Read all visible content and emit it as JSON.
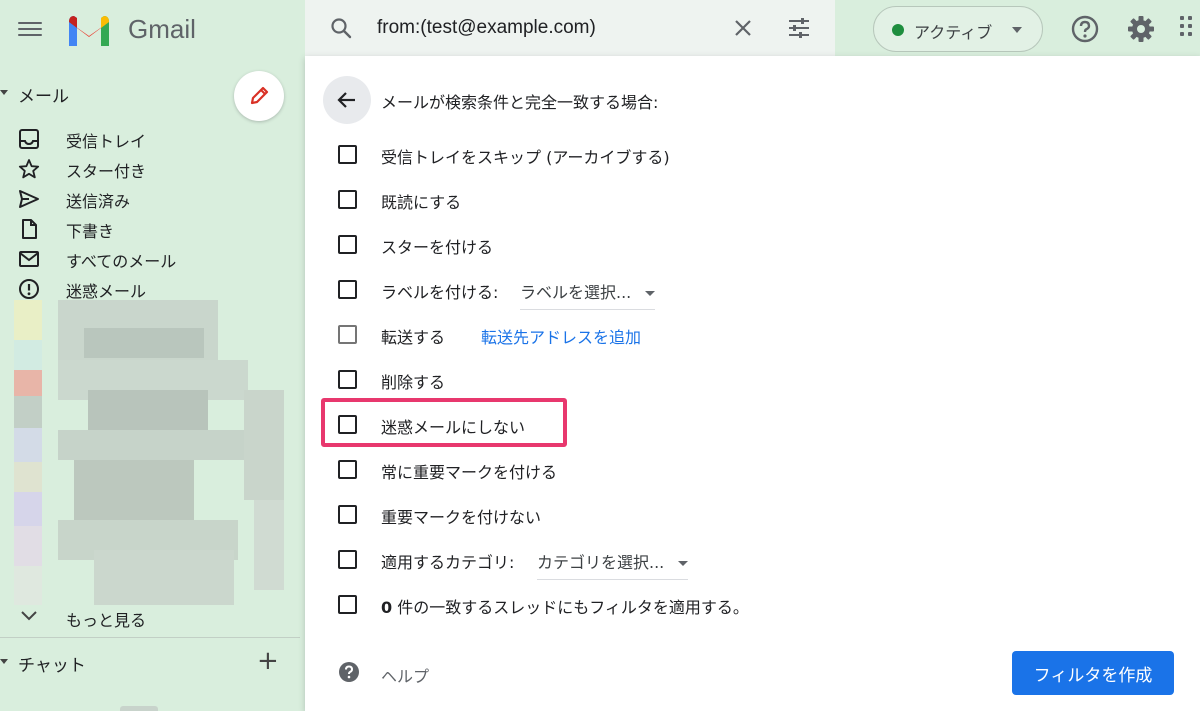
{
  "header": {
    "brand": "Gmail",
    "search_query": "from:(test@example.com)",
    "status_label": "アクティブ",
    "status_color": "#1e8e3e"
  },
  "sidebar": {
    "mail_section_title": "メール",
    "items": [
      {
        "label": "受信トレイ",
        "icon": "inbox-icon"
      },
      {
        "label": "スター付き",
        "icon": "star-icon"
      },
      {
        "label": "送信済み",
        "icon": "send-icon"
      },
      {
        "label": "下書き",
        "icon": "draft-icon"
      },
      {
        "label": "すべてのメール",
        "icon": "mail-icon"
      },
      {
        "label": "迷惑メール",
        "icon": "spam-icon"
      }
    ],
    "more_label": "もっと見る",
    "chat_label": "チャット"
  },
  "filter": {
    "title": "メールが検索条件と完全一致する場合:",
    "options": [
      {
        "label": "受信トレイをスキップ (アーカイブする)",
        "checked": false
      },
      {
        "label": "既読にする",
        "checked": false
      },
      {
        "label": "スターを付ける",
        "checked": false
      },
      {
        "label": "ラベルを付ける:",
        "checked": false,
        "select": "ラベルを選択..."
      },
      {
        "label": "転送する",
        "checked": false,
        "link": "転送先アドレスを追加"
      },
      {
        "label": "削除する",
        "checked": false
      },
      {
        "label": "迷惑メールにしない",
        "checked": false
      },
      {
        "label": "常に重要マークを付ける",
        "checked": false
      },
      {
        "label": "重要マークを付けない",
        "checked": false
      },
      {
        "label": "適用するカテゴリ:",
        "checked": false,
        "select": "カテゴリを選択..."
      },
      {
        "count": "0",
        "label": " 件の一致するスレッドにもフィルタを適用する。",
        "checked": false
      }
    ],
    "help_label": "ヘルプ",
    "create_button": "フィルタを作成",
    "accent_color": "#1a73e8",
    "highlight_color": "#e8386e"
  }
}
